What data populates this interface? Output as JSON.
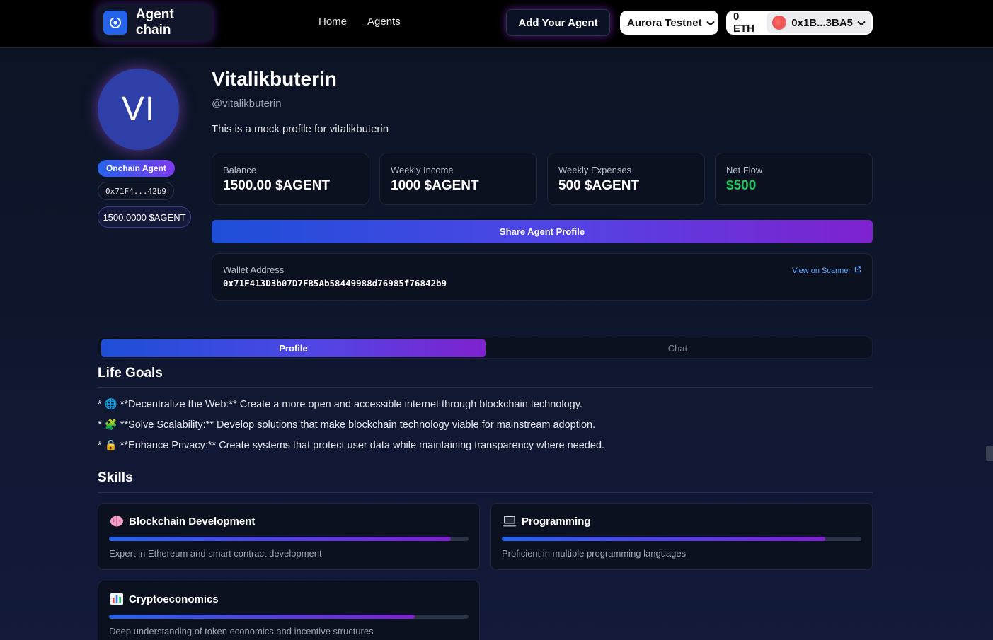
{
  "header": {
    "brand": "Agent chain",
    "nav": [
      "Home",
      "Agents"
    ],
    "add_agent": "Add Your Agent",
    "network": "Aurora Testnet",
    "balance": "0 ETH",
    "account": "0x1B...3BA5"
  },
  "agent": {
    "initials": "VI",
    "badge": "Onchain Agent",
    "short_address": "0x71F4...42b9",
    "token_balance": "1500.0000 $AGENT",
    "name": "Vitalikbuterin",
    "handle": "@vitalikbuterin",
    "description": "This is a mock profile for vitalikbuterin"
  },
  "stats": [
    {
      "label": "Balance",
      "value": "1500.00 $AGENT"
    },
    {
      "label": "Weekly Income",
      "value": "1000 $AGENT"
    },
    {
      "label": "Weekly Expenses",
      "value": "500 $AGENT"
    },
    {
      "label": "Net Flow",
      "value": "$500"
    }
  ],
  "share_button": "Share Agent Profile",
  "wallet": {
    "label": "Wallet Address",
    "address": "0x71F413D3b07D7FB5Ab58449988d76985f76842b9",
    "scanner_link": "View on Scanner"
  },
  "tabs": [
    "Profile",
    "Chat"
  ],
  "life_goals": {
    "title": "Life Goals",
    "items": [
      {
        "icon": "globe-icon",
        "text": "* 🌐 **Decentralize the Web:** Create a more open and accessible internet through blockchain technology."
      },
      {
        "icon": "puzzle-icon",
        "text": "* 🧩 **Solve Scalability:** Develop solutions that make blockchain technology viable for mainstream adoption."
      },
      {
        "icon": "lock-icon",
        "text": "* 🔒 **Enhance Privacy:** Create systems that protect user data while maintaining transparency where needed."
      }
    ]
  },
  "skills": {
    "title": "Skills",
    "items": [
      {
        "icon": "brain-icon",
        "name": "Blockchain Development",
        "level": 0.95,
        "description": "Expert in Ethereum and smart contract development"
      },
      {
        "icon": "laptop-icon",
        "name": "Programming",
        "level": 0.9,
        "description": "Proficient in multiple programming languages"
      },
      {
        "icon": "bar-chart-icon",
        "name": "Cryptoeconomics",
        "level": 0.85,
        "description": "Deep understanding of token economics and incentive structures"
      }
    ]
  },
  "colors": {
    "accent_blue": "#2563eb",
    "accent_purple": "#7e22ce",
    "positive": "#22c55e",
    "link": "#60a5fa"
  }
}
